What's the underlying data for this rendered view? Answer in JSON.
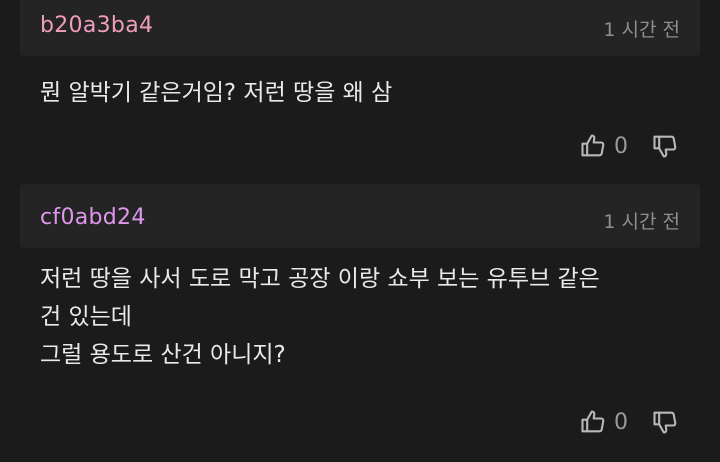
{
  "comments": [
    {
      "username": "b20a3ba4",
      "username_color": "#ef9dbd",
      "time": "1 시간 전",
      "lines": [
        "뭔 알박기 같은거임? 저런 땅을 왜 삼"
      ],
      "likes": "0",
      "like_icon": "thumbs-up-icon",
      "dislike_icon": "thumbs-down-icon"
    },
    {
      "username": "cf0abd24",
      "username_color": "#df97ec",
      "time": "1 시간 전",
      "lines": [
        "저런 땅을 사서 도로 막고 공장 이랑 쇼부 보는 유투브 같은",
        "건 있는데",
        "그럴 용도로 산건 아니지?"
      ],
      "likes": "0",
      "like_icon": "thumbs-up-icon",
      "dislike_icon": "thumbs-down-icon"
    }
  ],
  "colors": {
    "background": "#1b1b1b",
    "header_background": "#242424",
    "text": "#e9e9e9",
    "muted": "#8f8f8f"
  }
}
